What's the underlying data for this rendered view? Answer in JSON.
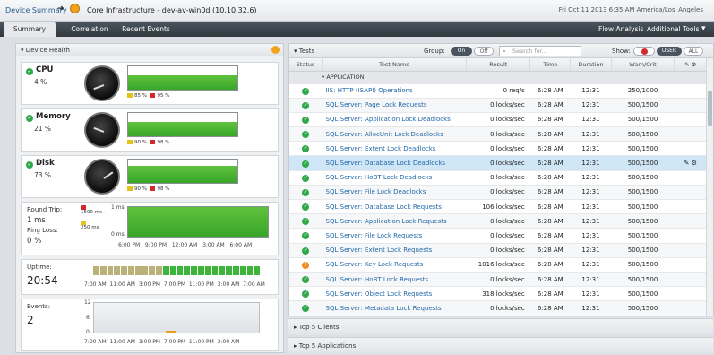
{
  "header": {
    "breadcrumb": "Device Summary",
    "device": "Core Infrastructure - dev-av-win0d (10.10.32.6)",
    "datetime": "Fri Oct 11 2013 6:35 AM America/Los_Angeles"
  },
  "tabs": [
    "Summary",
    "Correlation",
    "Recent Events"
  ],
  "right_tabs": [
    "Flow Analysis",
    "Additional Tools"
  ],
  "device_health": {
    "title": "Device Health",
    "cpu": {
      "name": "CPU",
      "value": "4 %",
      "leg1": "85 %",
      "leg2": "95 %",
      "level": 0.04
    },
    "memory": {
      "name": "Memory",
      "value": "21 %",
      "leg1": "90 %",
      "leg2": "98 %",
      "level": 0.21
    },
    "disk": {
      "name": "Disk",
      "value": "73 %",
      "leg1": "90 %",
      "leg2": "98 %",
      "level": 0.73
    },
    "roundtrip": {
      "label": "Round Trip:",
      "value": "1 ms",
      "loss_label": "Ping Loss:",
      "loss_value": "0 %",
      "leg1": "1500 ms",
      "leg2": "250 ms",
      "y_top": "1 ms",
      "y_bottom": "0 ms",
      "xticks": [
        "6:00 PM",
        "9:00 PM",
        "12:00 AM",
        "3:00 AM",
        "6:00 AM"
      ]
    },
    "uptime": {
      "label": "Uptime:",
      "value": "20:54",
      "xticks": [
        "7:00 AM",
        "11:00 AM",
        "3:00 PM",
        "7:00 PM",
        "11:00 PM",
        "3:00 AM",
        "7:00 AM"
      ]
    },
    "events": {
      "label": "Events:",
      "value": "2",
      "y_ticks": [
        "12",
        "6",
        "0"
      ],
      "xticks": [
        "7:00 AM",
        "11:00 AM",
        "3:00 PM",
        "7:00 PM",
        "11:00 PM",
        "3:00 AM"
      ]
    }
  },
  "tests": {
    "title": "Tests",
    "group_label": "Group:",
    "on": "On",
    "off": "Off",
    "search_placeholder": "Search for...",
    "show_label": "Show:",
    "user": "USER",
    "all": "ALL",
    "columns": [
      "Status",
      "Test Name",
      "Result",
      "Time",
      "Duration",
      "Warn/Crit"
    ],
    "group_name": "APPLICATION",
    "rows": [
      {
        "status": "ok",
        "name": "IIS: HTTP (ISAPI) Operations",
        "result": "0 req/s",
        "time": "6:28 AM",
        "duration": "12:31",
        "warn": "250/1000"
      },
      {
        "status": "ok",
        "name": "SQL Server: Page Lock Requests",
        "result": "0 locks/sec",
        "time": "6:28 AM",
        "duration": "12:31",
        "warn": "500/1500"
      },
      {
        "status": "ok",
        "name": "SQL Server: Application Lock Deadlocks",
        "result": "0 locks/sec",
        "time": "6:28 AM",
        "duration": "12:31",
        "warn": "500/1500"
      },
      {
        "status": "ok",
        "name": "SQL Server: AllocUnit Lock Deadlocks",
        "result": "0 locks/sec",
        "time": "6:28 AM",
        "duration": "12:31",
        "warn": "500/1500"
      },
      {
        "status": "ok",
        "name": "SQL Server: Extent Lock Deadlocks",
        "result": "0 locks/sec",
        "time": "6:28 AM",
        "duration": "12:31",
        "warn": "500/1500"
      },
      {
        "status": "ok",
        "name": "SQL Server: Database Lock Deadlocks",
        "result": "0 locks/sec",
        "time": "6:28 AM",
        "duration": "12:31",
        "warn": "500/1500"
      },
      {
        "status": "ok",
        "name": "SQL Server: HoBT Lock Deadlocks",
        "result": "0 locks/sec",
        "time": "6:28 AM",
        "duration": "12:31",
        "warn": "500/1500"
      },
      {
        "status": "ok",
        "name": "SQL Server: File Lock Deadlocks",
        "result": "0 locks/sec",
        "time": "6:28 AM",
        "duration": "12:31",
        "warn": "500/1500"
      },
      {
        "status": "ok",
        "name": "SQL Server: Database Lock Requests",
        "result": "106 locks/sec",
        "time": "6:28 AM",
        "duration": "12:31",
        "warn": "500/1500"
      },
      {
        "status": "ok",
        "name": "SQL Server: Application Lock Requests",
        "result": "0 locks/sec",
        "time": "6:28 AM",
        "duration": "12:31",
        "warn": "500/1500"
      },
      {
        "status": "ok",
        "name": "SQL Server: File Lock Requests",
        "result": "0 locks/sec",
        "time": "6:28 AM",
        "duration": "12:31",
        "warn": "500/1500"
      },
      {
        "status": "ok",
        "name": "SQL Server: Extent Lock Requests",
        "result": "0 locks/sec",
        "time": "6:28 AM",
        "duration": "12:31",
        "warn": "500/1500"
      },
      {
        "status": "warn",
        "name": "SQL Server: Key Lock Requests",
        "result": "1016 locks/sec",
        "time": "6:28 AM",
        "duration": "12:31",
        "warn": "500/1500"
      },
      {
        "status": "ok",
        "name": "SQL Server: HoBT Lock Requests",
        "result": "0 locks/sec",
        "time": "6:28 AM",
        "duration": "12:31",
        "warn": "500/1500"
      },
      {
        "status": "ok",
        "name": "SQL Server: Object Lock Requests",
        "result": "318 locks/sec",
        "time": "6:28 AM",
        "duration": "12:31",
        "warn": "500/1500"
      },
      {
        "status": "ok",
        "name": "SQL Server: Metadata Lock Requests",
        "result": "0 locks/sec",
        "time": "6:28 AM",
        "duration": "12:31",
        "warn": "500/1500"
      }
    ],
    "selected_row": 5
  },
  "collapsed": {
    "clients": "Top 5 Clients",
    "applications": "Top 5 Applications"
  }
}
